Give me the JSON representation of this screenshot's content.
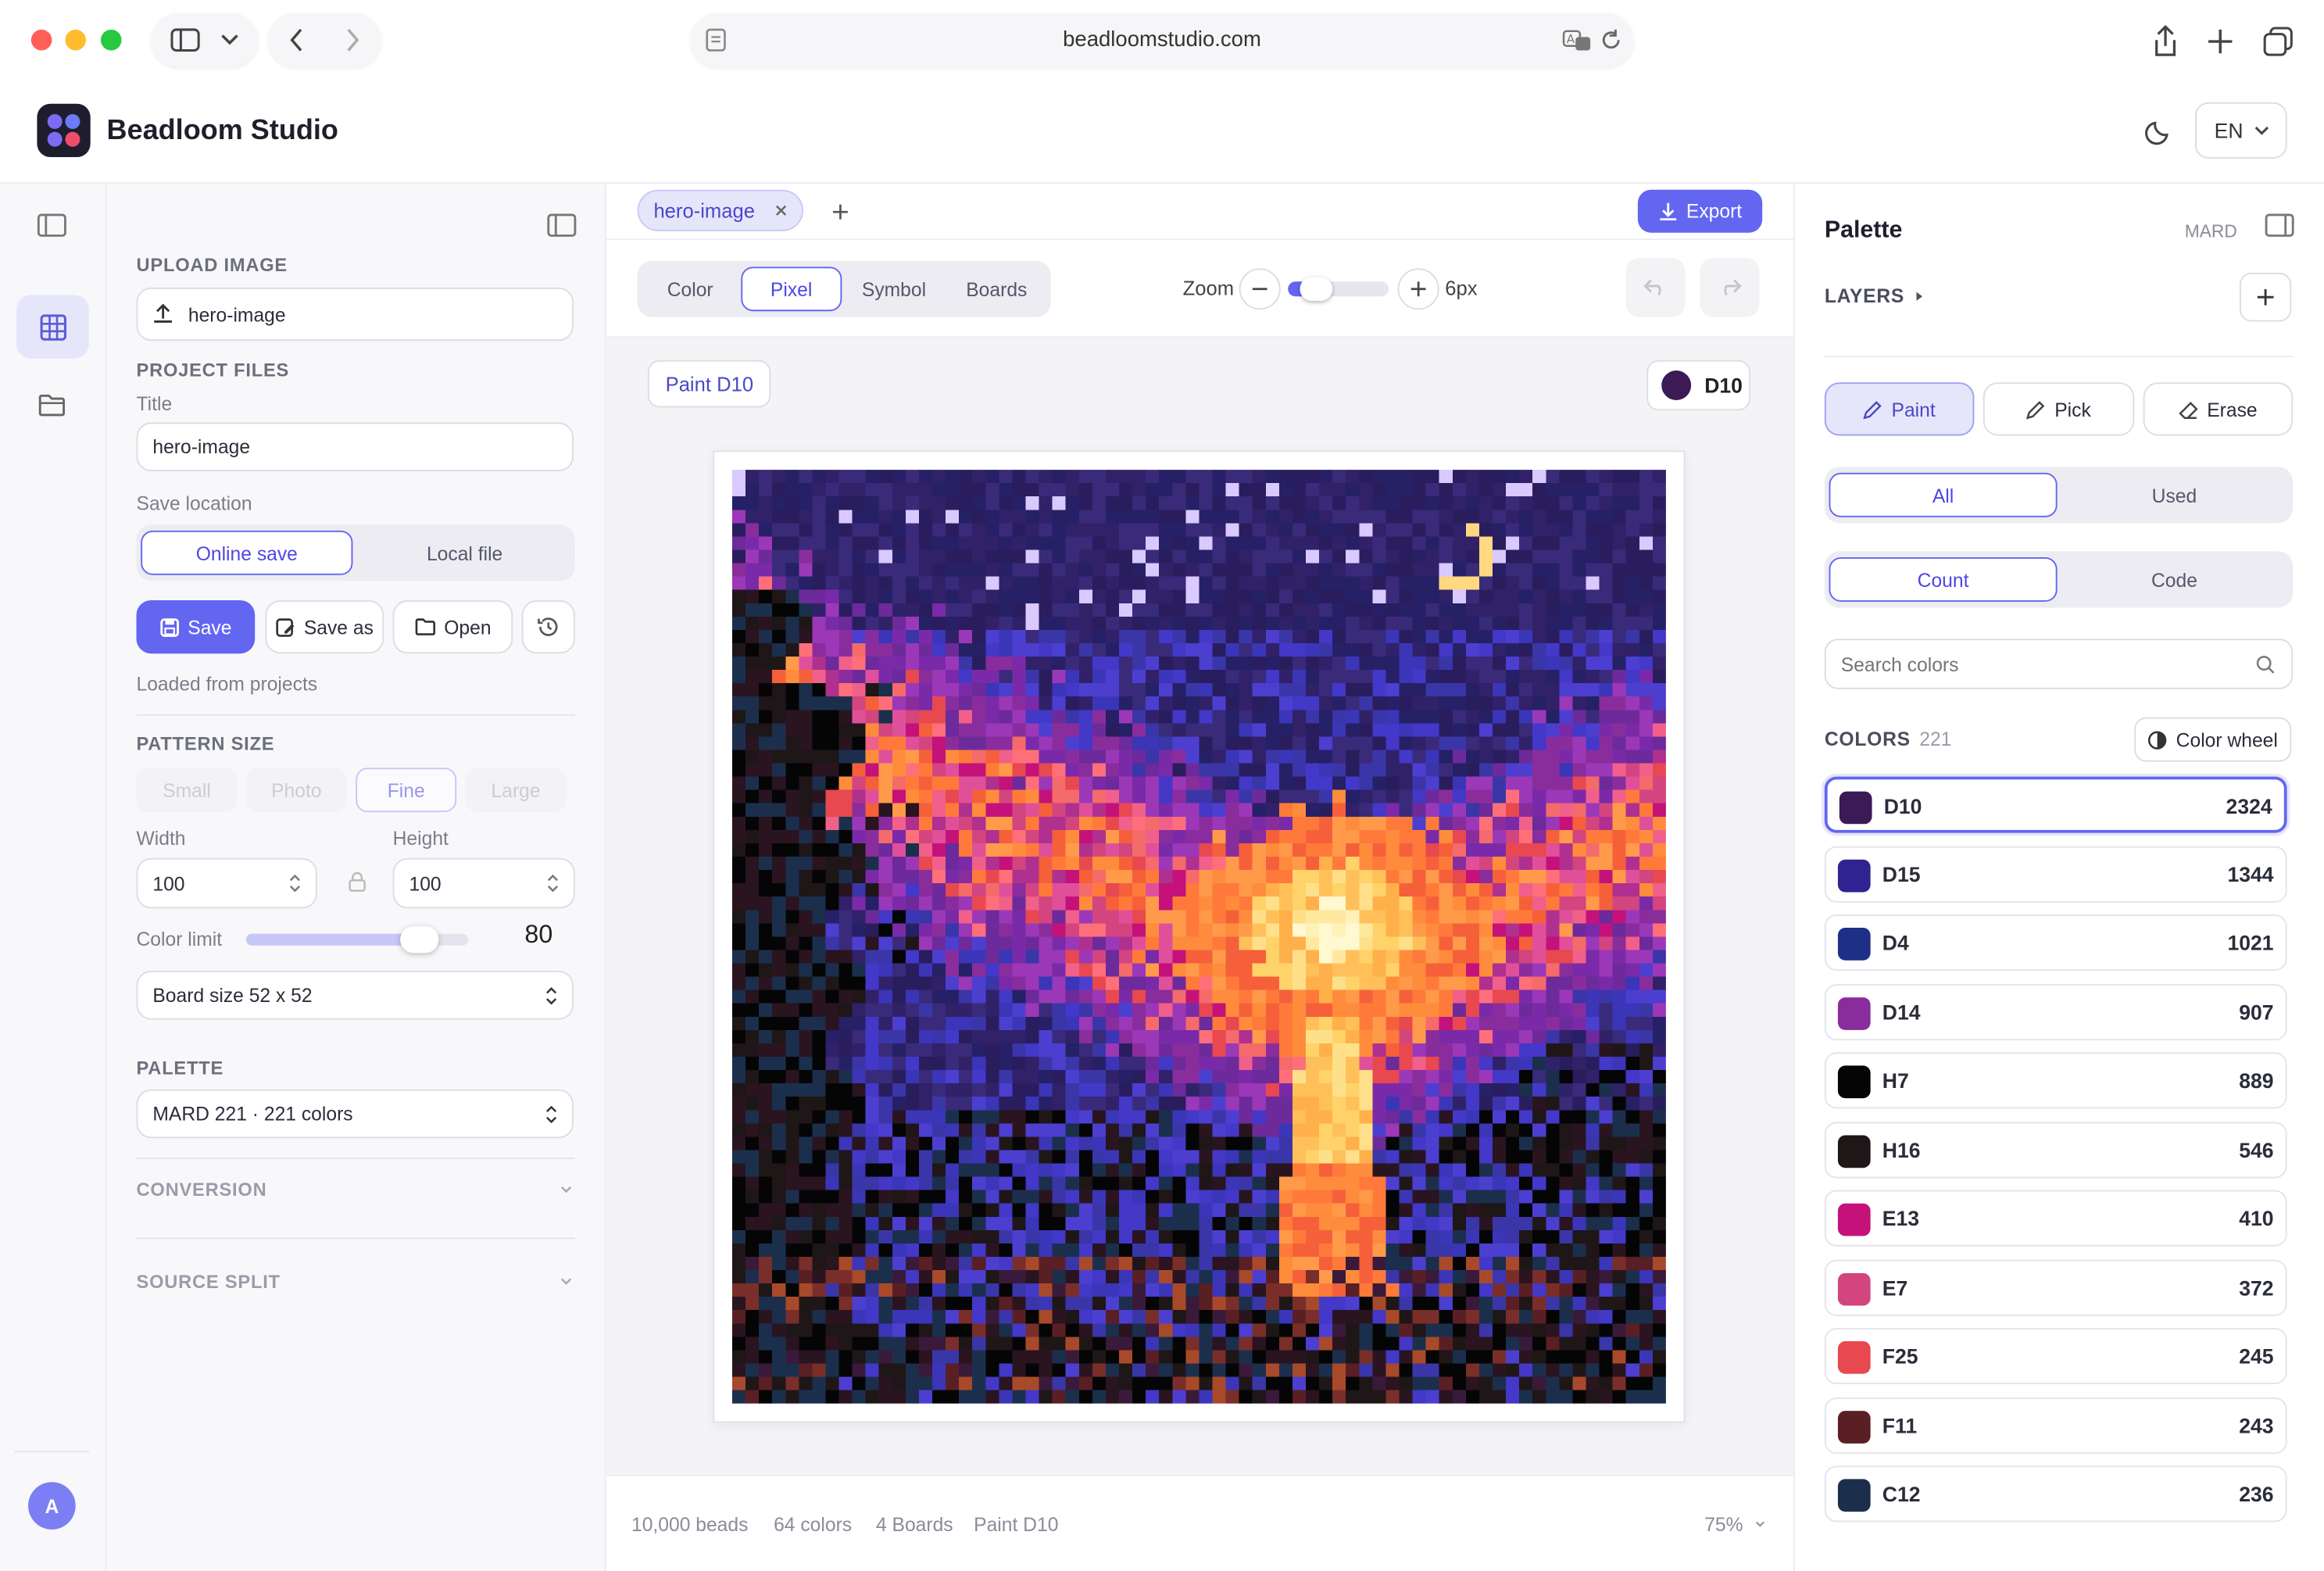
{
  "browser": {
    "url": "beadloomstudio.com"
  },
  "app": {
    "name": "Beadloom Studio",
    "language": "EN",
    "avatar_initial": "A"
  },
  "left_panel": {
    "upload_title": "UPLOAD IMAGE",
    "upload_file": "hero-image",
    "project_title": "PROJECT FILES",
    "title_label": "Title",
    "title_value": "hero-image",
    "save_location_label": "Save location",
    "save_options": [
      "Online save",
      "Local file"
    ],
    "save_label": "Save",
    "save_as_label": "Save as",
    "open_label": "Open",
    "loaded_text": "Loaded from projects",
    "pattern_title": "PATTERN SIZE",
    "pattern_options": [
      "Small",
      "Photo",
      "Fine",
      "Large"
    ],
    "width_label": "Width",
    "width_value": "100",
    "height_label": "Height",
    "height_value": "100",
    "color_limit_label": "Color limit",
    "color_limit_value": "80",
    "color_limit_fraction": 0.78,
    "board_size": "Board size 52 x 52",
    "palette_title": "PALETTE",
    "palette_value": "MARD 221 · 221 colors",
    "conversion_label": "CONVERSION",
    "source_split_label": "SOURCE SPLIT"
  },
  "center": {
    "tab_name": "hero-image",
    "export_label": "Export",
    "view_modes": [
      "Color",
      "Pixel",
      "Symbol",
      "Boards"
    ],
    "active_mode": "Pixel",
    "zoom_label": "Zoom",
    "zoom_value": "6px",
    "zoom_fraction": 0.12,
    "paint_badge": "Paint D10",
    "current_color": "D10",
    "status": {
      "beads": "10,000 beads",
      "colors": "64 colors",
      "boards": "4 Boards",
      "mode": "Paint D10",
      "zoom": "75%"
    }
  },
  "right_panel": {
    "title": "Palette",
    "brand": "MARD",
    "layers_label": "LAYERS",
    "tools": [
      "Paint",
      "Pick",
      "Erase"
    ],
    "filter_tabs": [
      "All",
      "Used"
    ],
    "sort_tabs": [
      "Count",
      "Code"
    ],
    "search_placeholder": "Search colors",
    "colors_label": "COLORS",
    "colors_count": "221",
    "color_wheel_label": "Color wheel",
    "colors": [
      {
        "code": "D10",
        "count": "2324",
        "hex": "#3b1a55"
      },
      {
        "code": "D15",
        "count": "1344",
        "hex": "#2e2390"
      },
      {
        "code": "D4",
        "count": "1021",
        "hex": "#1d2f86"
      },
      {
        "code": "D14",
        "count": "907",
        "hex": "#8a2d9c"
      },
      {
        "code": "H7",
        "count": "889",
        "hex": "#050506"
      },
      {
        "code": "H16",
        "count": "546",
        "hex": "#1f1618"
      },
      {
        "code": "E13",
        "count": "410",
        "hex": "#c4127a"
      },
      {
        "code": "E7",
        "count": "372",
        "hex": "#d2457f"
      },
      {
        "code": "F25",
        "count": "245",
        "hex": "#e8484f"
      },
      {
        "code": "F11",
        "count": "243",
        "hex": "#5a1f24"
      },
      {
        "code": "C12",
        "count": "236",
        "hex": "#1b2f4d"
      }
    ]
  },
  "theme": {
    "accent": "#6366f1",
    "canvas_bg": "#f4f4f7"
  }
}
